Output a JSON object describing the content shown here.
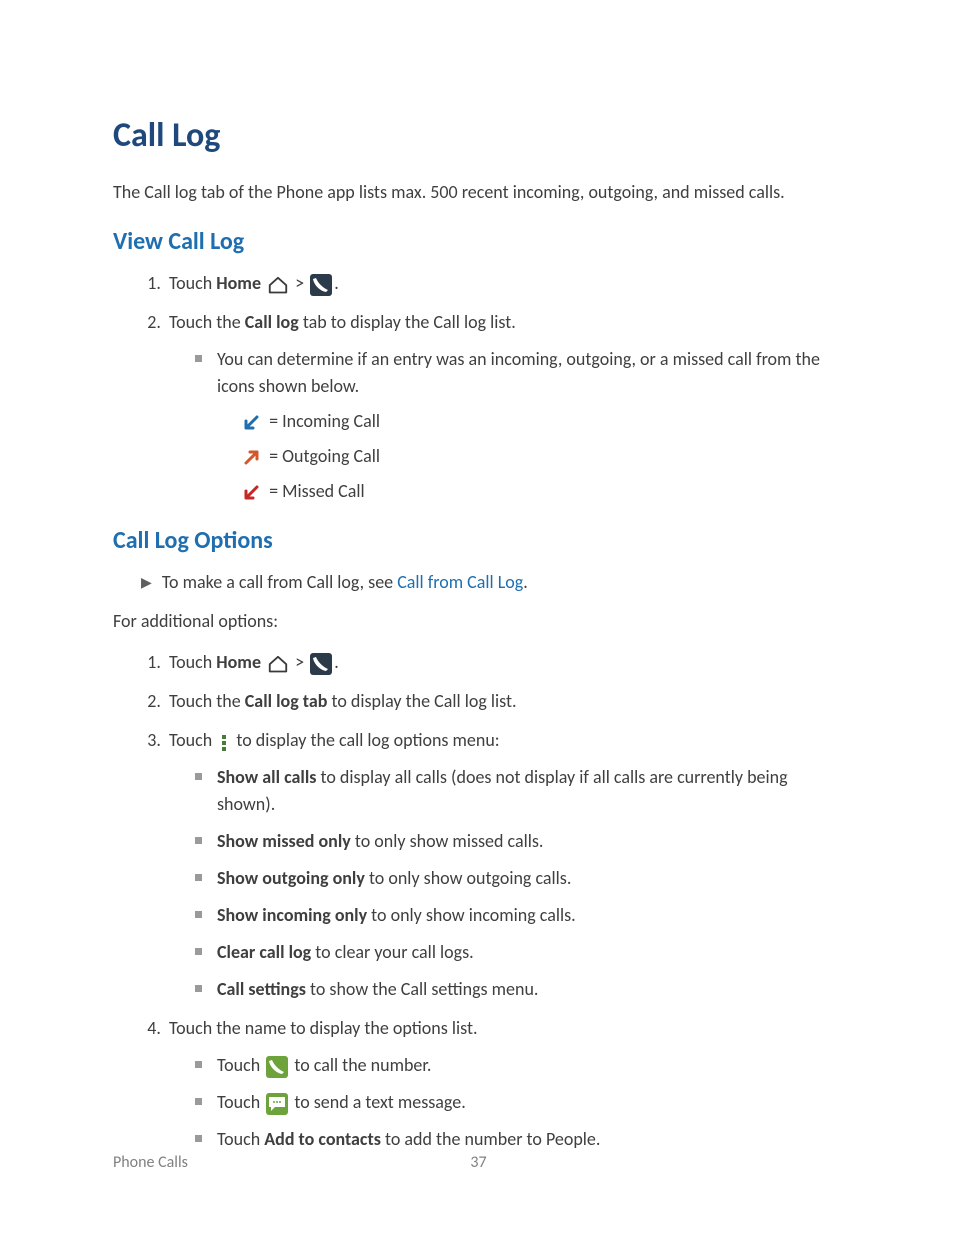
{
  "title": "Call Log",
  "intro": "The Call log tab of the Phone app lists max. 500 recent incoming, outgoing, and missed calls.",
  "section_view": {
    "heading": "View Call Log",
    "step1_pre": "Touch ",
    "step1_home": "Home",
    "step1_gt": " > ",
    "step1_post": ".",
    "step2_pre": "Touch the ",
    "step2_bold": "Call log",
    "step2_post": " tab to display the Call log list.",
    "sub1": "You can determine if an entry was an incoming, outgoing, or a missed call from the icons shown below.",
    "legend": {
      "incoming": " = Incoming Call",
      "outgoing": " = Outgoing Call",
      "missed": " = Missed Call"
    }
  },
  "section_options": {
    "heading": "Call Log Options",
    "arrow_line_pre": "To make a call from Call log, see ",
    "arrow_link": "Call from Call Log",
    "arrow_line_post": ".",
    "additional": "For additional options:",
    "step1_pre": "Touch ",
    "step1_home": "Home",
    "step1_gt": " > ",
    "step1_post": ".",
    "step2_pre": "Touch the ",
    "step2_bold": "Call log tab",
    "step2_post": " to display the Call log list.",
    "step3_pre": "Touch ",
    "step3_post": " to display the call log options menu:",
    "opts": {
      "show_all_b": "Show all calls",
      "show_all_t": " to display all calls (does not display if all calls are currently being shown).",
      "missed_b": "Show missed only",
      "missed_t": " to only show missed calls.",
      "out_b": "Show outgoing only",
      "out_t": " to only show outgoing calls.",
      "in_b": "Show incoming only",
      "in_t": " to only show incoming calls.",
      "clear_b": "Clear call log",
      "clear_t": " to clear your call logs.",
      "settings_b": "Call settings",
      "settings_t": " to show the Call settings menu."
    },
    "step4": "Touch the name to display the options list.",
    "step4_sub": {
      "call_pre": "Touch ",
      "call_post": " to call the number.",
      "msg_pre": "Touch ",
      "msg_post": " to send a text message.",
      "add_pre": "Touch ",
      "add_b": "Add to contacts",
      "add_post": " to add the number to People."
    }
  },
  "footer": {
    "section": "Phone Calls",
    "page": "37"
  }
}
